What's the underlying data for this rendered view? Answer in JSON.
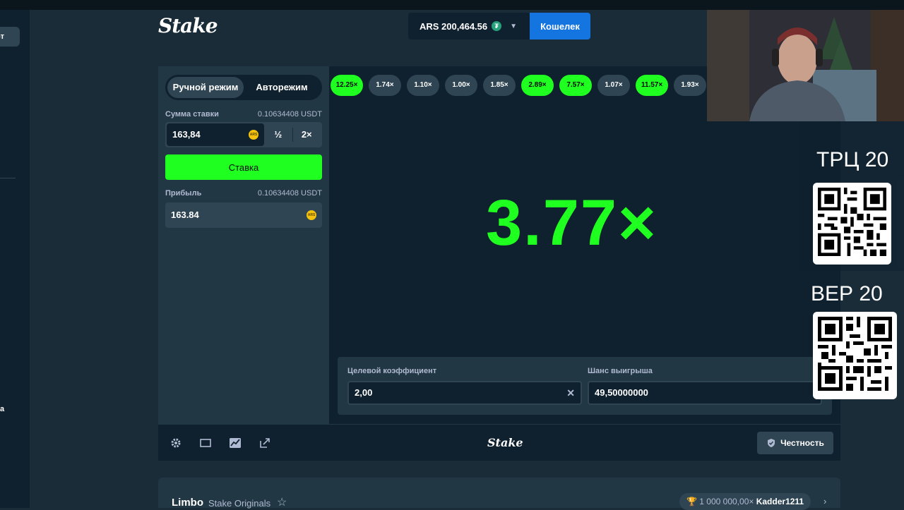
{
  "left_rail": {
    "chip_text": "рт",
    "fragment": "а"
  },
  "header": {
    "logo": "Stake",
    "balance": "ARS 200,464.56",
    "currency_icon": "tether-icon",
    "wallet_label": "Кошелек"
  },
  "controls": {
    "tabs": [
      "Ручной режим",
      "Авторежим"
    ],
    "active_tab": 0,
    "bet_label": "Сумма ставки",
    "bet_usd": "0.10634408 USDT",
    "bet_value": "163,84",
    "coin_label": "ARS",
    "half": "½",
    "double": "2×",
    "bet_button": "Ставка",
    "profit_label": "Прибыль",
    "profit_usd": "0.10634408 USDT",
    "profit_value": "163.84"
  },
  "game": {
    "history": [
      {
        "value": "12.25×",
        "win": true
      },
      {
        "value": "1.74×",
        "win": false
      },
      {
        "value": "1.10×",
        "win": false
      },
      {
        "value": "1.00×",
        "win": false
      },
      {
        "value": "1.85×",
        "win": false
      },
      {
        "value": "2.89×",
        "win": true
      },
      {
        "value": "7.57×",
        "win": true
      },
      {
        "value": "1.07×",
        "win": false
      },
      {
        "value": "11.57×",
        "win": true
      },
      {
        "value": "1.93×",
        "win": false
      }
    ],
    "result": "3.77×",
    "target_label": "Целевой коэффициент",
    "target_value": "2,00",
    "chance_label": "Шанс выигрыша",
    "chance_value": "49,50000000"
  },
  "footer": {
    "logo": "Stake",
    "fairness": "Честность",
    "icons": [
      "gear-icon",
      "theatre-icon",
      "stats-icon",
      "popout-icon"
    ]
  },
  "info": {
    "name": "Limbo",
    "brand": "Stake Originals",
    "record_value": "1 000 000,00×",
    "record_user": "Kadder1211"
  },
  "stream": {
    "label_1": "ТРЦ 20",
    "label_2": "ВЕР 20"
  },
  "colors": {
    "background": "#1a2c38",
    "panel": "#213743",
    "accent_green": "#1fff20",
    "wallet_blue": "#1475e1"
  }
}
